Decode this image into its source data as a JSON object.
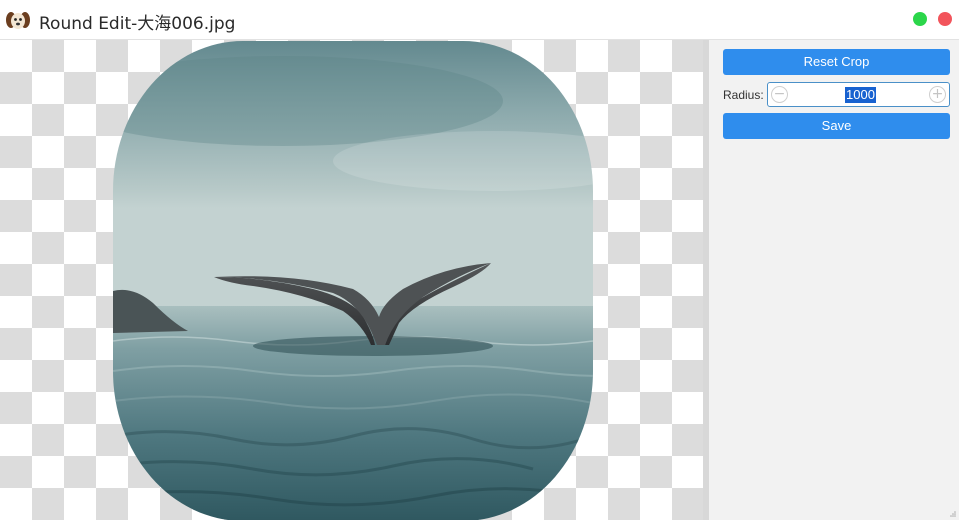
{
  "window": {
    "title": "Round Edit-大海006.jpg",
    "icon": "dog-app-icon",
    "controls": [
      {
        "name": "maximize",
        "color": "#2bd64a"
      },
      {
        "name": "close",
        "color": "#f2545b"
      }
    ]
  },
  "canvas": {
    "background": "transparency-checkerboard",
    "image": "whale-tail-ocean-photo"
  },
  "panel": {
    "reset_label": "Reset Crop",
    "radius_label": "Radius:",
    "radius_value": "1000",
    "save_label": "Save"
  },
  "colors": {
    "accent": "#2f8ded",
    "selection": "#1862d0",
    "panel_bg": "#f2f2f2"
  }
}
